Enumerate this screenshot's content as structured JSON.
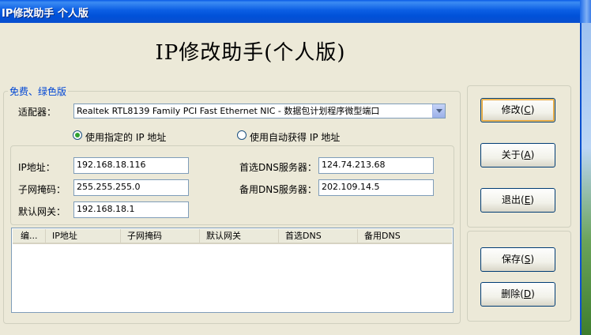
{
  "window": {
    "title": "IP修改助手  个人版"
  },
  "heading": "IP修改助手(个人版)",
  "group_label": "免费、绿色版",
  "adapter": {
    "label": "适配器：",
    "value": "Realtek RTL8139 Family PCI Fast Ethernet NIC - 数据包计划程序微型端口"
  },
  "mode": {
    "static_label": "使用指定的 IP 地址",
    "dhcp_label": "使用自动获得 IP 地址",
    "selected": "static"
  },
  "fields": {
    "ip_label": "IP地址：",
    "ip_value": "192.168.18.116",
    "mask_label": "子网掩码：",
    "mask_value": "255.255.255.0",
    "gateway_label": "默认网关：",
    "gateway_value": "192.168.18.1",
    "dns1_label": "首选DNS服务器：",
    "dns1_value": "124.74.213.68",
    "dns2_label": "备用DNS服务器：",
    "dns2_value": "202.109.14.5"
  },
  "table": {
    "columns": [
      "编...",
      "IP地址",
      "子网掩码",
      "默认网关",
      "首选DNS",
      "备用DNS"
    ],
    "rows": []
  },
  "buttons": {
    "modify": {
      "text": "修改(",
      "key": "C"
    },
    "about": {
      "text": "关于(",
      "key": "A"
    },
    "exit": {
      "text": "退出(",
      "key": "E"
    },
    "save": {
      "text": "保存(",
      "key": "S"
    },
    "delete": {
      "text": "删除(",
      "key": "D"
    },
    "close_paren": ")"
  }
}
